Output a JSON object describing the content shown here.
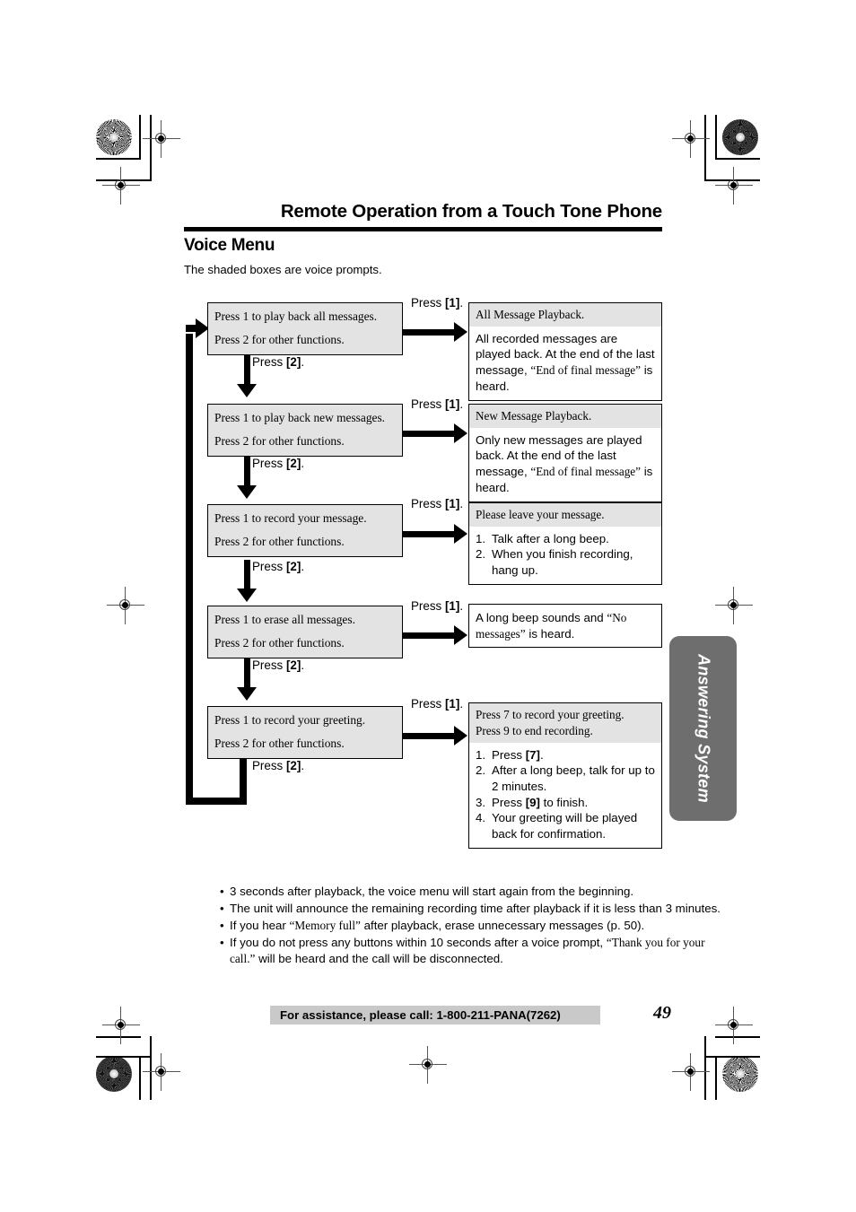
{
  "header": {
    "chapter_title": "Remote Operation from a Touch Tone Phone",
    "section_title": "Voice Menu",
    "subtitle": "The shaded boxes are voice prompts."
  },
  "flow": {
    "press_one_label_prefix": "Press ",
    "press_one_key": "[1]",
    "press_one_suffix": ".",
    "press_two_label_prefix": "Press ",
    "press_two_key": "[2]",
    "press_two_suffix": ".",
    "steps": [
      {
        "menu": {
          "line1": "Press 1 to play back all messages.",
          "line2": "Press 2 for other functions."
        },
        "branch_label": "Press [1].",
        "down_label": "Press [2].",
        "response": {
          "prompt": "All Message Playback.",
          "body_prefix": "All recorded messages are played back. At the end of the last message, ",
          "body_quote": "“End of final message”",
          "body_suffix": " is heard."
        }
      },
      {
        "menu": {
          "line1": "Press 1 to play back new messages.",
          "line2": "Press 2 for other functions."
        },
        "branch_label": "Press [1].",
        "down_label": "Press [2].",
        "response": {
          "prompt": "New Message Playback.",
          "body_prefix": "Only new messages are played back. At the end of the last message, ",
          "body_quote": "“End of final message”",
          "body_suffix": " is heard."
        }
      },
      {
        "menu": {
          "line1": "Press 1 to record your message.",
          "line2": "Press 2 for other functions."
        },
        "branch_label": "Press [1].",
        "down_label": "Press [2].",
        "response": {
          "prompt": "Please leave your message.",
          "items": [
            {
              "num": "1.",
              "text": "Talk after a long beep."
            },
            {
              "num": "2.",
              "text": "When you finish recording, hang up."
            }
          ]
        }
      },
      {
        "menu": {
          "line1": "Press 1 to erase all messages.",
          "line2": "Press 2 for other functions."
        },
        "branch_label": "Press [1].",
        "down_label": "Press [2].",
        "response": {
          "plain_prefix": "A long beep sounds and ",
          "plain_quote": "“No messages”",
          "plain_suffix": " is heard."
        }
      },
      {
        "menu": {
          "line1": "Press 1 to record your greeting.",
          "line2": "Press 2 for other functions."
        },
        "branch_label": "Press [1].",
        "down_label": "Press [2].",
        "response": {
          "prompt_line1": "Press 7 to record your greeting.",
          "prompt_line2": "Press 9 to end recording.",
          "items": [
            {
              "num": "1.",
              "pre": "Press ",
              "key": "[7]",
              "post": "."
            },
            {
              "num": "2.",
              "pre": "After a long beep, talk for up to 2 minutes.",
              "key": "",
              "post": ""
            },
            {
              "num": "3.",
              "pre": "Press ",
              "key": "[9]",
              "post": " to finish."
            },
            {
              "num": "4.",
              "pre": "Your greeting will be played back for confirmation.",
              "key": "",
              "post": ""
            }
          ]
        }
      }
    ]
  },
  "notes": [
    {
      "pre": "3 seconds after playback, the voice menu will start again from the beginning.",
      "quote": "",
      "post": ""
    },
    {
      "pre": "The unit will announce the remaining recording time after playback if it is less than 3 minutes.",
      "quote": "",
      "post": ""
    },
    {
      "pre": "If you hear ",
      "quote": "“Memory full”",
      "post": " after playback, erase unnecessary messages (p. 50)."
    },
    {
      "pre": "If you do not press any buttons within 10 seconds after a voice prompt, ",
      "quote": "“Thank you for your call.”",
      "post": " will be heard and the call will be disconnected."
    }
  ],
  "side_tab": {
    "label": "Answering System"
  },
  "footer": {
    "assistance_text": "For assistance, please call: 1-800-211-PANA(7262)",
    "page_number": "49"
  },
  "colors": {
    "shaded_box": "#e3e3e3",
    "side_tab": "#6e6e6e",
    "footer_band": "#c9c9c9"
  }
}
